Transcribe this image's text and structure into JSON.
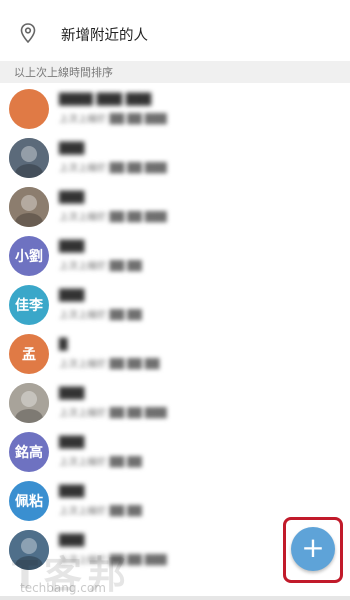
{
  "header": {
    "add_nearby_label": "新增附近的人",
    "section_label": "以上次上線時間排序",
    "pin_icon": "location-pin-icon"
  },
  "contacts": [
    {
      "avatar_kind": "solid",
      "avatar_color": "#e07a45",
      "avatar_text": "",
      "name": "████ ███ ███",
      "status": "上次上線於 ██ ██ ███"
    },
    {
      "avatar_kind": "photo",
      "avatar_color": "#5b6a7a",
      "avatar_text": "",
      "name": "███",
      "status": "上次上線於 ██ ██ ███"
    },
    {
      "avatar_kind": "photo",
      "avatar_color": "#8c7d6e",
      "avatar_text": "",
      "name": "███",
      "status": "上次上線於 ██ ██ ███"
    },
    {
      "avatar_kind": "initials",
      "avatar_color": "#6e72c1",
      "avatar_text": "小劉",
      "name": "███",
      "status": "上次上線於 ██ ██"
    },
    {
      "avatar_kind": "initials",
      "avatar_color": "#3aa7c9",
      "avatar_text": "佳李",
      "name": "███",
      "status": "上次上線於 ██ ██"
    },
    {
      "avatar_kind": "initials",
      "avatar_color": "#e07a45",
      "avatar_text": "孟",
      "name": "█",
      "status": "上次上線於 ██ ██ ██"
    },
    {
      "avatar_kind": "photo",
      "avatar_color": "#a8a39a",
      "avatar_text": "",
      "name": "███",
      "status": "上次上線於 ██ ██ ███"
    },
    {
      "avatar_kind": "initials",
      "avatar_color": "#6e72c1",
      "avatar_text": "銘高",
      "name": "███",
      "status": "上次上線於 ██ ██"
    },
    {
      "avatar_kind": "initials",
      "avatar_color": "#3a8fd0",
      "avatar_text": "佩粘",
      "name": "███",
      "status": "上次上線於 ██ ██"
    },
    {
      "avatar_kind": "photo",
      "avatar_color": "#4f6f8a",
      "avatar_text": "",
      "name": "███",
      "status": "上次上線於 ██ ██ ███"
    }
  ],
  "fab": {
    "label": "+",
    "color": "#5ea3d8",
    "highlight_color": "#c11a2a",
    "icon": "plus-icon"
  },
  "watermark": {
    "text": "T客邦",
    "subtext": "techbang.com"
  }
}
